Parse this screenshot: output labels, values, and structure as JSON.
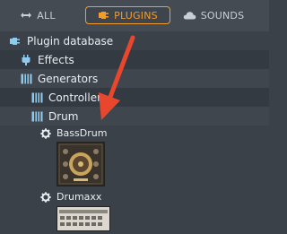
{
  "tabs": {
    "all": "ALL",
    "plugins": "PLUGINS",
    "sounds": "SOUNDS"
  },
  "tree": {
    "root": "Plugin database",
    "effects": "Effects",
    "generators": "Generators",
    "controller": "Controller",
    "drum": "Drum"
  },
  "plugins": {
    "bassdrum": "BassDrum",
    "drumaxx": "Drumaxx"
  },
  "colors": {
    "accent": "#f39c2a",
    "tree_icon": "#8ec9ee",
    "arrow": "#e9472d"
  },
  "icons": {
    "all_tab": "arrows-icon",
    "plugins_tab": "plug-icon",
    "sounds_tab": "cloud-icon",
    "folder_root": "plug-icon",
    "effects": "plug-icon",
    "generators": "piano-keys-icon",
    "controller": "piano-keys-icon",
    "drum": "piano-keys-icon",
    "plugin": "gear-icon"
  }
}
